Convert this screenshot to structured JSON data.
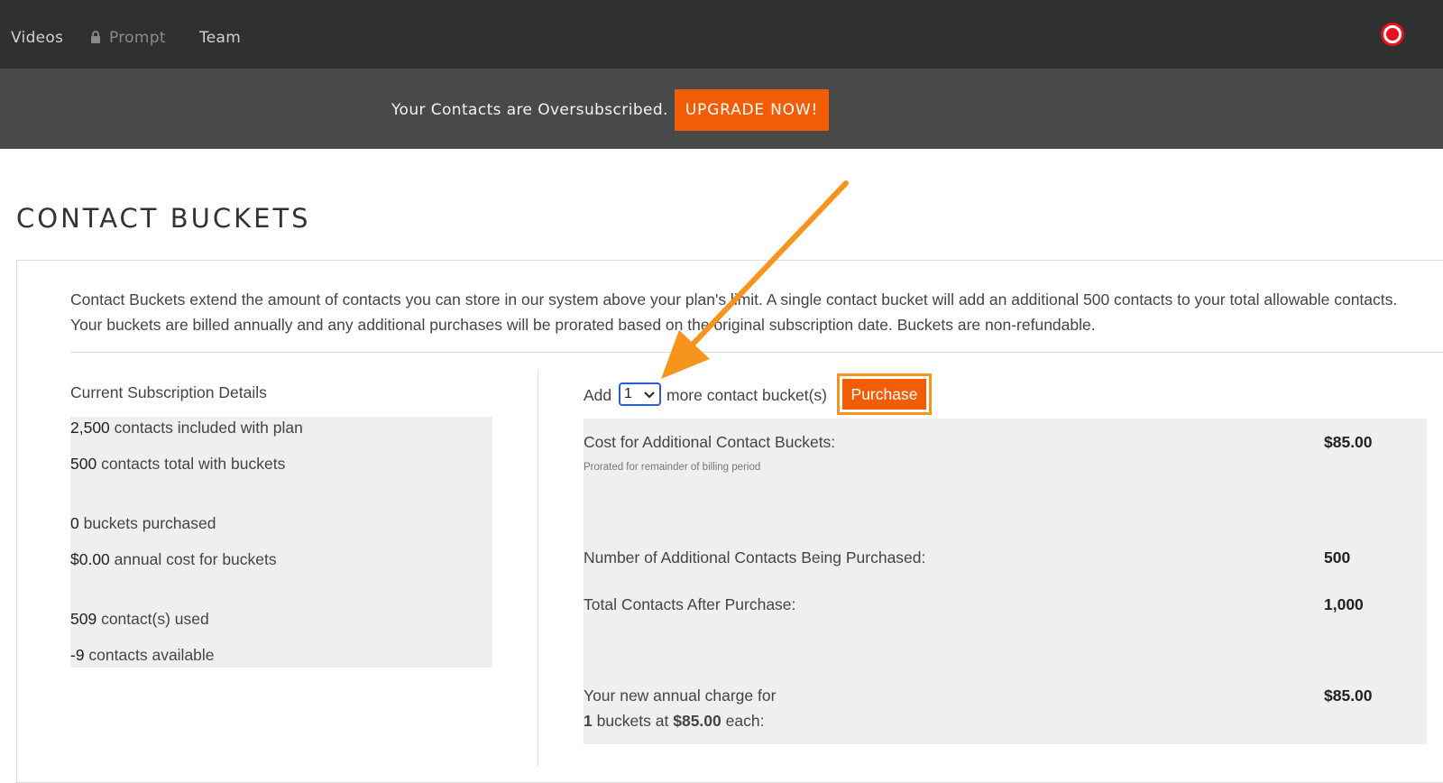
{
  "nav": {
    "items": [
      {
        "label": "Videos"
      },
      {
        "label": "Prompt",
        "icon": "lock-icon"
      },
      {
        "label": "Team"
      }
    ],
    "record_icon": "record-icon",
    "record_color": "#e8111b"
  },
  "banner": {
    "message": "Your Contacts are Oversubscribed.",
    "upgrade_label": "UPGRADE NOW!",
    "accent": "#f25c05"
  },
  "page": {
    "title": "CONTACT BUCKETS",
    "intro": "Contact Buckets extend the amount of contacts you can store in our system above your plan's limit. A single contact bucket will add an additional 500 contacts to your total allowable contacts. Your buckets are billed annually and any additional purchases will be prorated based on the original subscription date. Buckets are non-refundable."
  },
  "subscription": {
    "heading": "Current Subscription Details",
    "lines": [
      {
        "value": "2,500",
        "text": " contacts included with plan"
      },
      {
        "value": "500",
        "text": " contacts total with buckets"
      },
      {
        "value": "0",
        "text": " buckets purchased"
      },
      {
        "value": "$0.00",
        "text": " annual cost for buckets"
      },
      {
        "value": "509",
        "text": " contact(s) used"
      },
      {
        "value": "-9",
        "text": " contacts available"
      }
    ]
  },
  "purchase": {
    "add_label": "Add",
    "quantity": "1",
    "more_label": "more contact bucket(s)",
    "button_label": "Purchase",
    "highlight_color": "#f7941e"
  },
  "costs": {
    "additional_label": "Cost for Additional Contact Buckets:",
    "additional_sub": "Prorated for remainder of billing period",
    "additional_value": "$85.00",
    "contacts_label": "Number of Additional Contacts Being Purchased:",
    "contacts_value": "500",
    "total_label": "Total Contacts After Purchase:",
    "total_value": "1,000",
    "annual_label_1": "Your new annual charge for",
    "annual_buckets": "1",
    "annual_mid": " buckets at ",
    "annual_price": "$85.00",
    "annual_end": " each:",
    "annual_value": "$85.00"
  }
}
